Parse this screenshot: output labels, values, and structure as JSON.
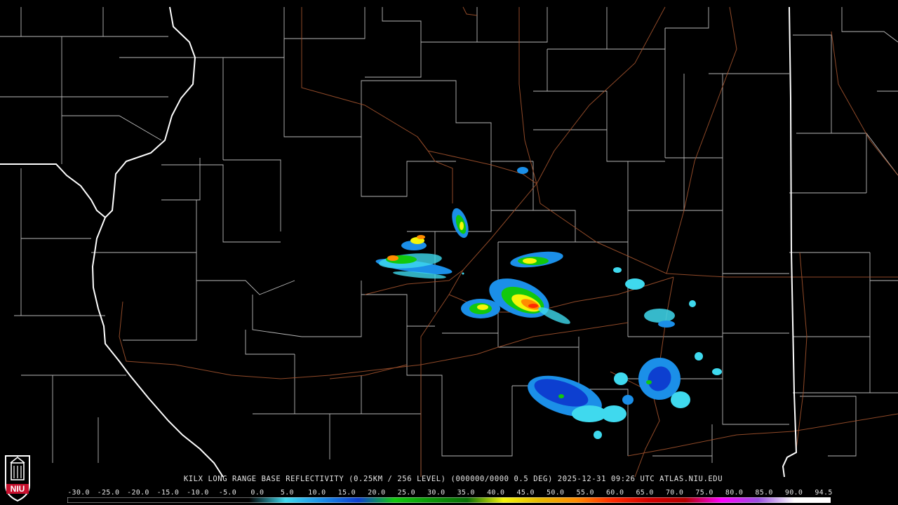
{
  "caption": "KILX LONG RANGE BASE REFLECTIVITY (0.25KM / 256 LEVEL) (000000/0000 0.5 DEG) 2025-12-31 09:26 UTC  ATLAS.NIU.EDU",
  "scale": {
    "labels": [
      "-30.0",
      "-25.0",
      "-20.0",
      "-15.0",
      "-10.0",
      "-5.0",
      "0.0",
      "5.0",
      "10.0",
      "15.0",
      "20.0",
      "25.0",
      "30.0",
      "35.0",
      "40.0",
      "45.0",
      "50.0",
      "55.0",
      "60.0",
      "65.0",
      "70.0",
      "75.0",
      "80.0",
      "85.0",
      "90.0",
      "94.5"
    ],
    "colors": [
      "#000000",
      "#000000",
      "#000000",
      "#000000",
      "#000000",
      "#000000",
      "#3fd9ee",
      "#1b8fe8",
      "#0d3fd0",
      "#12c80e",
      "#0c9608",
      "#0a6e06",
      "#f5f50a",
      "#e6b800",
      "#ff8c00",
      "#ff2a00",
      "#d40000",
      "#b40000",
      "#ff00ff",
      "#9a50e0",
      "#ffffff",
      "#ffffff"
    ]
  },
  "logo": {
    "text": "NIU"
  },
  "colors": {
    "background": "#000000",
    "county_lines": "#ffffff",
    "state_lines": "#ffffff",
    "roads": "#a0522d"
  }
}
